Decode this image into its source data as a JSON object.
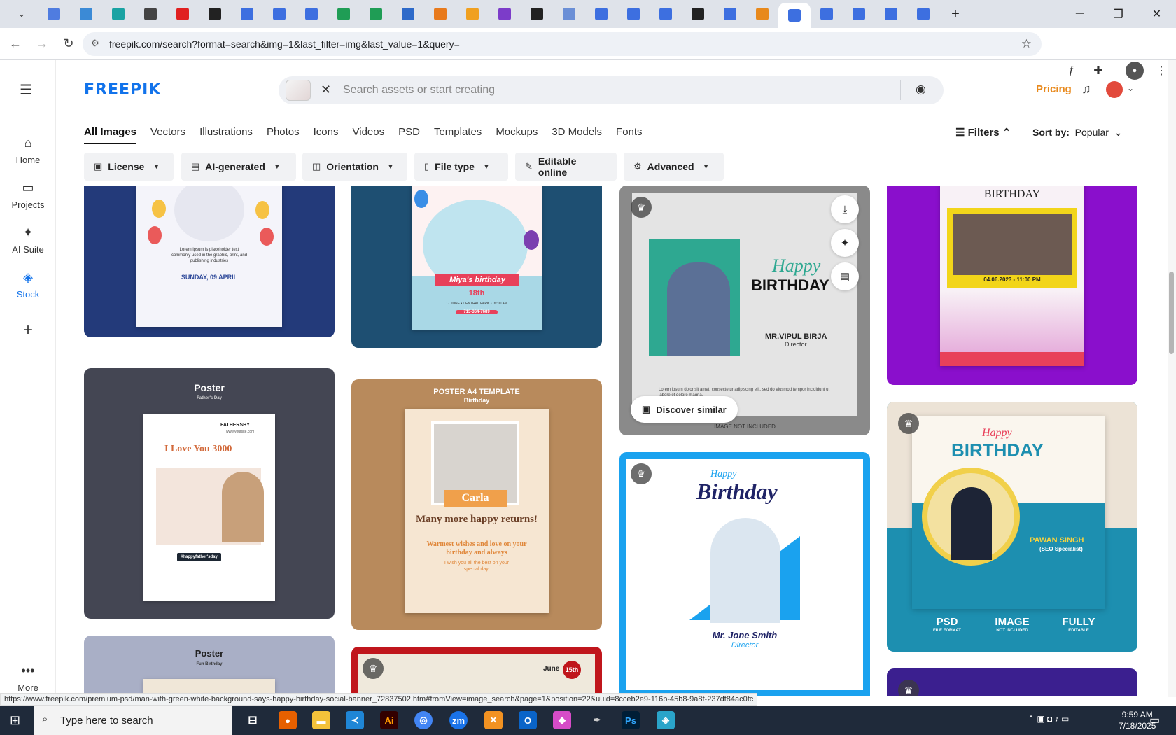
{
  "browser": {
    "url": "freepik.com/search?format=search&img=1&last_filter=img&last_value=1&query=",
    "tab_colors": [
      "#4f7ce0",
      "#3b8ad6",
      "#1aa3a3",
      "#444",
      "#e02020",
      "#222",
      "#3d6fe0",
      "#3d6fe0",
      "#3d6fe0",
      "#1f9d55",
      "#1f9d55",
      "#2e6ac9",
      "#e87a1c",
      "#f0a020",
      "#7c3cc9",
      "#222",
      "#6b8fd6",
      "#3d6fe0",
      "#3d6fe0",
      "#3d6fe0",
      "#222",
      "#3d6fe0",
      "#e8891c",
      "#3d6fe0",
      "#3d6fe0",
      "#3d6fe0",
      "#3d6fe0",
      "#3d6fe0"
    ],
    "new_tab": "+",
    "window_controls": [
      "─",
      "❐",
      "✕"
    ]
  },
  "rail": {
    "home": "Home",
    "projects": "Projects",
    "ai_suite": "AI Suite",
    "stock": "Stock",
    "more": "More"
  },
  "header": {
    "logo": "FREEPIK",
    "search_placeholder": "Search assets or start creating",
    "pricing": "Pricing"
  },
  "categories": [
    "All Images",
    "Vectors",
    "Illustrations",
    "Photos",
    "Icons",
    "Videos",
    "PSD",
    "Templates",
    "Mockups",
    "3D Models",
    "Fonts"
  ],
  "toolbar": {
    "filters": "Filters",
    "sort_label": "Sort by:",
    "sort_value": "Popular"
  },
  "chips": [
    "License",
    "AI-generated",
    "Orientation",
    "File type",
    "Editable online",
    "Advanced"
  ],
  "cards": {
    "c1": {
      "line1": "Lorem ipsum is placeholder text commonly used in the graphic, print, and publishing industries",
      "date": "SUNDAY, 09 APRIL"
    },
    "c2": {
      "name": "Miya's birthday",
      "age": "18th",
      "info": "17 JUNE • CENTRAL PARK • 09:00 AM",
      "phone": "713-364-7689"
    },
    "c3": {
      "script": "Happy",
      "title": "BIRTHDAY",
      "name": "MR.VIPUL BIRJA",
      "role": "Director",
      "lorem": "Lorem ipsum dolor sit amet, consectetur adipiscing elit, sed do eiusmod tempor incididunt ut labore et dolore magna.",
      "note": "IMAGE NOT INCLUDED",
      "discover": "Discover similar"
    },
    "c4": {
      "title": "BIRTHDAY",
      "date": "04.06.2023 - 11:00 PM"
    },
    "c5": {
      "title": "Poster",
      "subtitle": "Father's Day",
      "brand": "FATHERSHY",
      "site": "www.yoursite.com",
      "headline": "I Love You 3000",
      "hashtag": "#happyfather'sday"
    },
    "c6": {
      "title": "POSTER A4 TEMPLATE",
      "subtitle": "Birthday",
      "name": "Carla",
      "headline": "Many more happy returns!",
      "wishes": "Warmest wishes and love on your birthday and always",
      "small": "I wish you all the best on your special day."
    },
    "c7": {
      "script": "Happy",
      "title": "Birthday",
      "name": "Mr. Jone Smith",
      "role": "Director"
    },
    "c8": {
      "script": "Happy",
      "title": "BIRTHDAY",
      "name": "PAWAN SINGH",
      "role": "(SEO Specialist)",
      "f1": "PSD",
      "f1s": "FILE FORMAT",
      "f2": "IMAGE",
      "f2s": "NOT INCLUDED",
      "f3": "FULLY",
      "f3s": "EDITABLE"
    },
    "c9": {
      "title": "Poster",
      "subtitle": "Fun Birthday"
    },
    "c10": {
      "date": "June",
      "day": "15th"
    }
  },
  "status_url": "https://www.freepik.com/premium-psd/man-with-green-white-background-says-happy-birthday-social-banner_72837502.htm#fromView=image_search&page=1&position=22&uuid=8cceb2e9-116b-45b8-9a8f-237df84ac0fc",
  "taskbar": {
    "search_placeholder": "Type here to search",
    "time": "9:59 AM",
    "date": "7/18/2025"
  }
}
